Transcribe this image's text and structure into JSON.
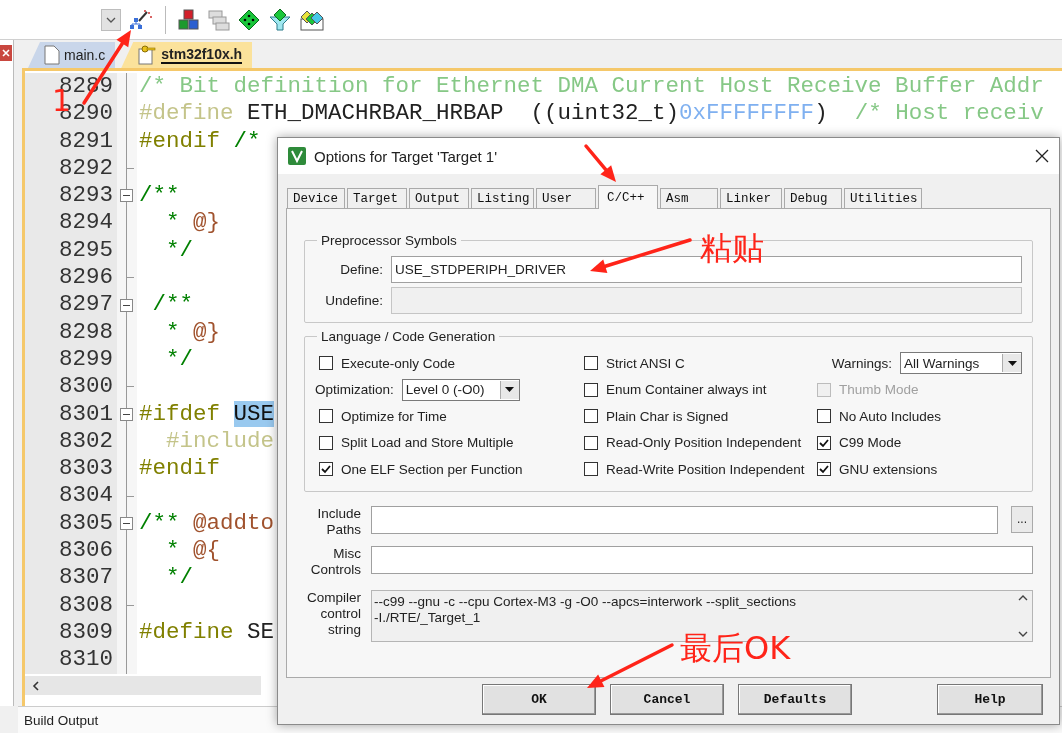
{
  "file_tabs": [
    {
      "label": "main.c",
      "selected": false
    },
    {
      "label": "stm32f10x.h",
      "selected": true
    }
  ],
  "editor": {
    "lines": [
      {
        "number": "8289",
        "fold_start": false,
        "fold_end": false,
        "tokens": [
          {
            "kind": "inactive_comment",
            "text": "/* Bit definition for Ethernet DMA Current Host Receive Buffer Addr"
          }
        ]
      },
      {
        "number": "8290",
        "fold_start": false,
        "fold_end": false,
        "tokens": [
          {
            "kind": "inactive_directive",
            "text": "#define"
          },
          {
            "kind": "plain",
            "text": " ETH_DMACHRBAR_HRBAP  ((uint32_t)"
          },
          {
            "kind": "inactive_number",
            "text": "0xFFFFFFFF"
          },
          {
            "kind": "plain",
            "text": ")  "
          },
          {
            "kind": "inactive_comment",
            "text": "/* Host receiv"
          }
        ]
      },
      {
        "number": "8291",
        "fold_start": false,
        "fold_end": false,
        "tokens": [
          {
            "kind": "directive",
            "text": "#endif"
          },
          {
            "kind": "comment",
            "text": " /*"
          }
        ]
      },
      {
        "number": "8292",
        "fold_start": false,
        "fold_end": true
      },
      {
        "number": "8293",
        "fold_start": true,
        "fold_end": false,
        "tokens": [
          {
            "kind": "comment",
            "text": "/**"
          }
        ]
      },
      {
        "number": "8294",
        "fold_start": false,
        "fold_end": false,
        "tokens": [
          {
            "kind": "comment",
            "text": "  * "
          },
          {
            "kind": "doctag",
            "text": "@}"
          }
        ]
      },
      {
        "number": "8295",
        "fold_start": false,
        "fold_end": false,
        "tokens": [
          {
            "kind": "comment",
            "text": "  */"
          }
        ]
      },
      {
        "number": "8296",
        "fold_start": false,
        "fold_end": true
      },
      {
        "number": "8297",
        "fold_start": true,
        "fold_end": false,
        "tokens": [
          {
            "kind": "comment",
            "text": " /**"
          }
        ]
      },
      {
        "number": "8298",
        "fold_start": false,
        "fold_end": false,
        "tokens": [
          {
            "kind": "comment",
            "text": "  * "
          },
          {
            "kind": "doctag",
            "text": "@}"
          }
        ]
      },
      {
        "number": "8299",
        "fold_start": false,
        "fold_end": false,
        "tokens": [
          {
            "kind": "comment",
            "text": "  */"
          }
        ]
      },
      {
        "number": "8300",
        "fold_start": false,
        "fold_end": true
      },
      {
        "number": "8301",
        "fold_start": true,
        "fold_end": false,
        "tokens": [
          {
            "kind": "directive",
            "text": "#ifdef "
          },
          {
            "kind": "highlight",
            "text": "USE"
          }
        ]
      },
      {
        "number": "8302",
        "fold_start": false,
        "fold_end": false,
        "tokens": [
          {
            "kind": "inactive_directive",
            "text": "  #include"
          }
        ]
      },
      {
        "number": "8303",
        "fold_start": false,
        "fold_end": false,
        "tokens": [
          {
            "kind": "directive",
            "text": "#endif"
          }
        ]
      },
      {
        "number": "8304",
        "fold_start": false,
        "fold_end": true
      },
      {
        "number": "8305",
        "fold_start": true,
        "fold_end": false,
        "tokens": [
          {
            "kind": "comment",
            "text": "/** "
          },
          {
            "kind": "doctag",
            "text": "@addto"
          }
        ]
      },
      {
        "number": "8306",
        "fold_start": false,
        "fold_end": false,
        "tokens": [
          {
            "kind": "comment",
            "text": "  * "
          },
          {
            "kind": "doctag",
            "text": "@{"
          }
        ]
      },
      {
        "number": "8307",
        "fold_start": false,
        "fold_end": false,
        "tokens": [
          {
            "kind": "comment",
            "text": "  */"
          }
        ]
      },
      {
        "number": "8308",
        "fold_start": false,
        "fold_end": true
      },
      {
        "number": "8309",
        "fold_start": false,
        "fold_end": false,
        "tokens": [
          {
            "kind": "directive",
            "text": "#define"
          },
          {
            "kind": "plain",
            "text": " SE"
          }
        ]
      },
      {
        "number": "8310",
        "fold_start": false,
        "fold_end": false
      }
    ]
  },
  "build_output": {
    "title": "Build Output"
  },
  "dialog": {
    "title": "Options for Target 'Target 1'",
    "tabs": [
      {
        "label": "Device",
        "selected": false
      },
      {
        "label": "Target",
        "selected": false
      },
      {
        "label": "Output",
        "selected": false
      },
      {
        "label": "Listing",
        "selected": false
      },
      {
        "label": "User",
        "selected": false
      },
      {
        "label": "C/C++",
        "selected": true
      },
      {
        "label": "Asm",
        "selected": false
      },
      {
        "label": "Linker",
        "selected": false
      },
      {
        "label": "Debug",
        "selected": false
      },
      {
        "label": "Utilities",
        "selected": false
      }
    ],
    "preprocessor": {
      "title": "Preprocessor Symbols",
      "define": {
        "label": "Define:",
        "value": "USE_STDPERIPH_DRIVER",
        "disabled": false
      },
      "undefine": {
        "label": "Undefine:",
        "disabled": true
      }
    },
    "language": {
      "title": "Language / Code Generation",
      "columns": [
        [
          {
            "kind": "checkbox",
            "label": "Execute-only Code",
            "checked": false,
            "disabled": false
          },
          {
            "kind": "select",
            "label": "Optimization:",
            "value": "Level 0 (-O0)"
          },
          {
            "kind": "checkbox",
            "label": "Optimize for Time",
            "checked": false,
            "disabled": false
          },
          {
            "kind": "checkbox",
            "label": "Split Load and Store Multiple",
            "checked": false,
            "disabled": false
          },
          {
            "kind": "checkbox",
            "label": "One ELF Section per Function",
            "checked": true,
            "disabled": false
          }
        ],
        [
          {
            "kind": "checkbox",
            "label": "Strict ANSI C",
            "checked": false,
            "disabled": false
          },
          {
            "kind": "checkbox",
            "label": "Enum Container always int",
            "checked": false,
            "disabled": false
          },
          {
            "kind": "checkbox",
            "label": "Plain Char is Signed",
            "checked": false,
            "disabled": false
          },
          {
            "kind": "checkbox",
            "label": "Read-Only Position Independent",
            "checked": false,
            "disabled": false
          },
          {
            "kind": "checkbox",
            "label": "Read-Write Position Independent",
            "checked": false,
            "disabled": false
          }
        ],
        [
          {
            "kind": "select",
            "label": "Warnings:",
            "value": "All Warnings"
          },
          {
            "kind": "checkbox",
            "label": "Thumb Mode",
            "checked": false,
            "disabled": true
          },
          {
            "kind": "checkbox",
            "label": "No Auto Includes",
            "checked": false,
            "disabled": false
          },
          {
            "kind": "checkbox",
            "label": "C99 Mode",
            "checked": true,
            "disabled": false
          },
          {
            "kind": "checkbox",
            "label": "GNU extensions",
            "checked": true,
            "disabled": false
          }
        ]
      ]
    },
    "include_paths": {
      "label": "Include\nPaths",
      "browse": "..."
    },
    "misc_controls": {
      "label": "Misc\nControls"
    },
    "compiler_string": {
      "label": "Compiler\ncontrol\nstring",
      "value": "--c99 --gnu -c --cpu Cortex-M3 -g -O0 --apcs=interwork --split_sections\n-I./RTE/_Target_1"
    },
    "buttons": [
      "OK",
      "Cancel",
      "Defaults",
      "Help"
    ]
  },
  "annotations": [
    {
      "kind": "label",
      "text": "1"
    },
    {
      "kind": "label",
      "text": "粘贴"
    },
    {
      "kind": "label",
      "text": "最后OK"
    }
  ]
}
